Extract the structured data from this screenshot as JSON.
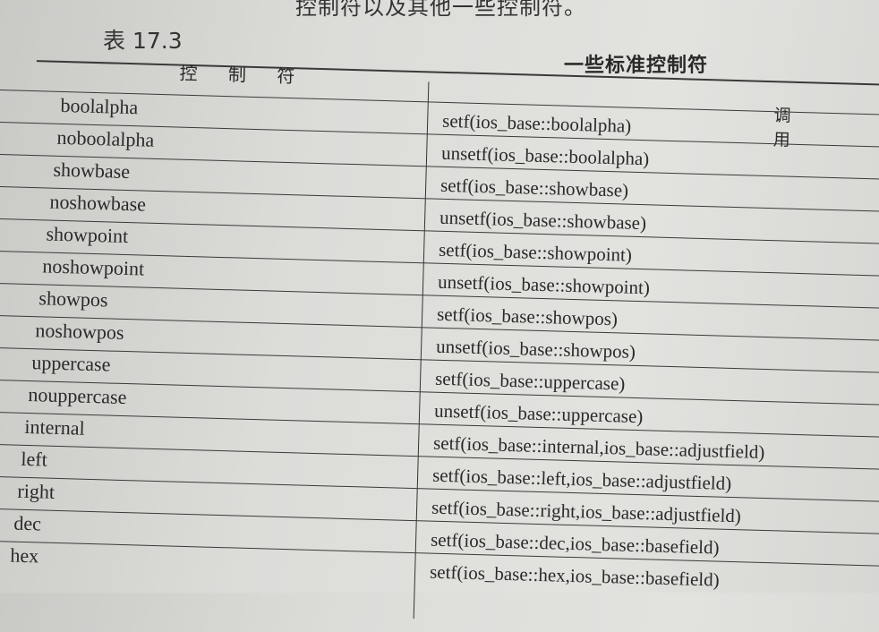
{
  "intro_text": "控制符以及其他一些控制符。",
  "caption": "表 17.3",
  "table_title": "一些标准控制符",
  "headers": {
    "manipulator": "控 制 符",
    "call": "调 用"
  },
  "rows": [
    {
      "manipulator": "boolalpha",
      "call": "setf(ios_base::boolalpha)"
    },
    {
      "manipulator": "noboolalpha",
      "call": "unsetf(ios_base::boolalpha)"
    },
    {
      "manipulator": "showbase",
      "call": "setf(ios_base::showbase)"
    },
    {
      "manipulator": "noshowbase",
      "call": "unsetf(ios_base::showbase)"
    },
    {
      "manipulator": "showpoint",
      "call": "setf(ios_base::showpoint)"
    },
    {
      "manipulator": "noshowpoint",
      "call": "unsetf(ios_base::showpoint)"
    },
    {
      "manipulator": "showpos",
      "call": "setf(ios_base::showpos)"
    },
    {
      "manipulator": "noshowpos",
      "call": "unsetf(ios_base::showpos)"
    },
    {
      "manipulator": "uppercase",
      "call": "setf(ios_base::uppercase)"
    },
    {
      "manipulator": "nouppercase",
      "call": "unsetf(ios_base::uppercase)"
    },
    {
      "manipulator": "internal",
      "call": "setf(ios_base::internal,ios_base::adjustfield)"
    },
    {
      "manipulator": "left",
      "call": "setf(ios_base::left,ios_base::adjustfield)"
    },
    {
      "manipulator": "right",
      "call": "setf(ios_base::right,ios_base::adjustfield)"
    },
    {
      "manipulator": "dec",
      "call": "setf(ios_base::dec,ios_base::basefield)"
    },
    {
      "manipulator": "hex",
      "call": "setf(ios_base::hex,ios_base::basefield)"
    }
  ]
}
